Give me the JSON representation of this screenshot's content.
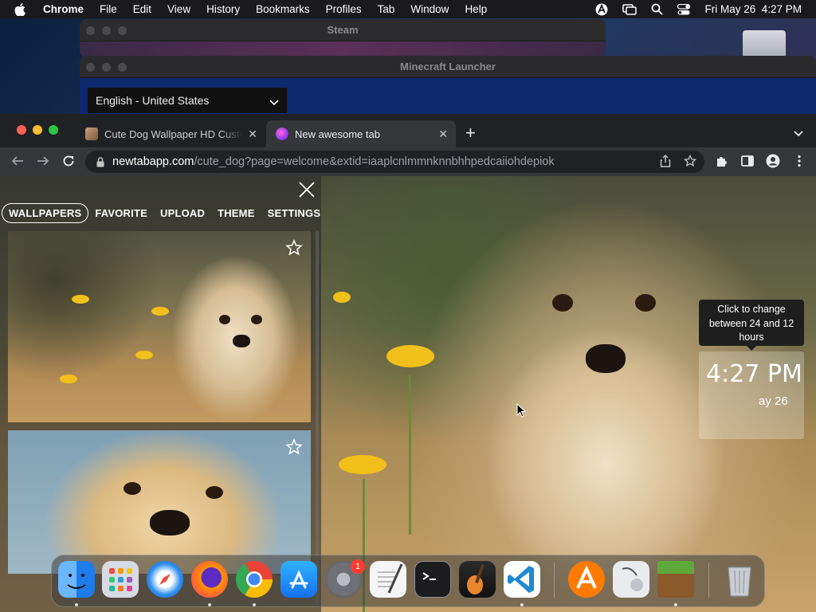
{
  "menubar": {
    "app_name": "Chrome",
    "items": [
      "File",
      "Edit",
      "View",
      "History",
      "Bookmarks",
      "Profiles",
      "Tab",
      "Window",
      "Help"
    ],
    "clock": "Fri May 26  4:27 PM"
  },
  "background_windows": {
    "steam_title": "Steam",
    "minecraft_title": "Minecraft Launcher",
    "minecraft_language": "English - United States"
  },
  "browser": {
    "tabs": [
      {
        "title": "Cute Dog Wallpaper HD Custom",
        "active": false
      },
      {
        "title": "New awesome tab",
        "active": true
      }
    ],
    "url_host": "newtabapp.com",
    "url_path": "/cute_dog?page=welcome&extid=iaaplcnlmmnknnbhhpedcaiiohdepiok"
  },
  "panel": {
    "tabs": [
      "WALLPAPERS",
      "FAVORITE",
      "UPLOAD",
      "THEME",
      "SETTINGS"
    ],
    "active_tab": "WALLPAPERS",
    "thumbnails": [
      {
        "subject": "fluffy cream puppy with yellow flowers"
      },
      {
        "subject": "golden retriever puppy close-up"
      }
    ]
  },
  "clock_widget": {
    "tooltip": "Click to change between 24 and 12 hours",
    "time": "4:27 PM",
    "date": "ay 26"
  },
  "dock": {
    "apps": [
      "Finder",
      "Launchpad",
      "Safari",
      "Firefox",
      "Chrome",
      "App Store",
      "System Preferences",
      "TextEdit",
      "Terminal",
      "GarageBand",
      "Visual Studio Code",
      "Avast",
      "Preview",
      "Minecraft",
      "Trash"
    ],
    "system_preferences_badge": "1"
  },
  "colors": {
    "chrome_dark": "#202124",
    "toolbar": "#35363a",
    "accent_red": "#ff3b30"
  }
}
